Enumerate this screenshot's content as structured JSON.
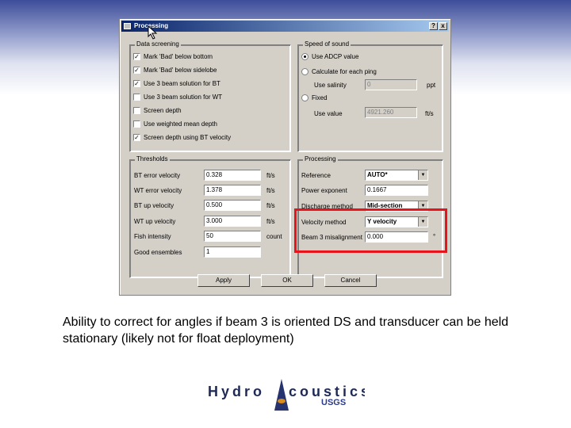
{
  "window": {
    "title": "Processing",
    "close_label": "x",
    "help_label": "?"
  },
  "data_screening": {
    "title": "Data screening",
    "items": [
      {
        "label": "Mark 'Bad' below bottom",
        "checked": true
      },
      {
        "label": "Mark 'Bad' below sidelobe",
        "checked": true
      },
      {
        "label": "Use 3 beam solution for BT",
        "checked": true
      },
      {
        "label": "Use 3 beam solution for WT",
        "checked": false
      },
      {
        "label": "Screen depth",
        "checked": false
      },
      {
        "label": "Use weighted mean depth",
        "checked": false
      },
      {
        "label": "Screen depth using BT velocity",
        "checked": true
      }
    ]
  },
  "speed_of_sound": {
    "title": "Speed of sound",
    "use_adcp": "Use ADCP value",
    "calculate": "Calculate for each ping",
    "use_salinity": "Use salinity",
    "salinity_value": "0",
    "salinity_unit": "ppt",
    "fixed": "Fixed",
    "use_value": "Use value",
    "fixed_value": "4921.260",
    "fixed_unit": "ft/s"
  },
  "thresholds": {
    "title": "Thresholds",
    "rows": [
      {
        "label": "BT error velocity",
        "value": "0.328",
        "unit": "ft/s"
      },
      {
        "label": "WT error velocity",
        "value": "1.378",
        "unit": "ft/s"
      },
      {
        "label": "BT up velocity",
        "value": "0.500",
        "unit": "ft/s"
      },
      {
        "label": "WT up velocity",
        "value": "3.000",
        "unit": "ft/s"
      },
      {
        "label": "Fish intensity",
        "value": "50",
        "unit": "count"
      },
      {
        "label": "Good ensembles",
        "value": "1",
        "unit": ""
      }
    ]
  },
  "processing": {
    "title": "Processing",
    "reference_label": "Reference",
    "reference_value": "AUTO*",
    "power_label": "Power exponent",
    "power_value": "0.1667",
    "discharge_label": "Discharge method",
    "discharge_value": "Mid-section",
    "velocity_label": "Velocity method",
    "velocity_value": "Y velocity",
    "beam3_label": "Beam 3 misalignment",
    "beam3_value": "0.000",
    "beam3_unit": "°"
  },
  "buttons": {
    "apply": "Apply",
    "ok": "OK",
    "cancel": "Cancel"
  },
  "caption": "Ability to correct for angles if beam 3 is oriented DS and transducer can be held stationary (likely not for float deployment)",
  "logo": {
    "left": "Hydro",
    "right": "coustics",
    "sub": "USGS"
  },
  "colors": {
    "highlight": "#e8141b",
    "title_bar": "#0a246a",
    "dialog_bg": "#d4d0c8"
  }
}
